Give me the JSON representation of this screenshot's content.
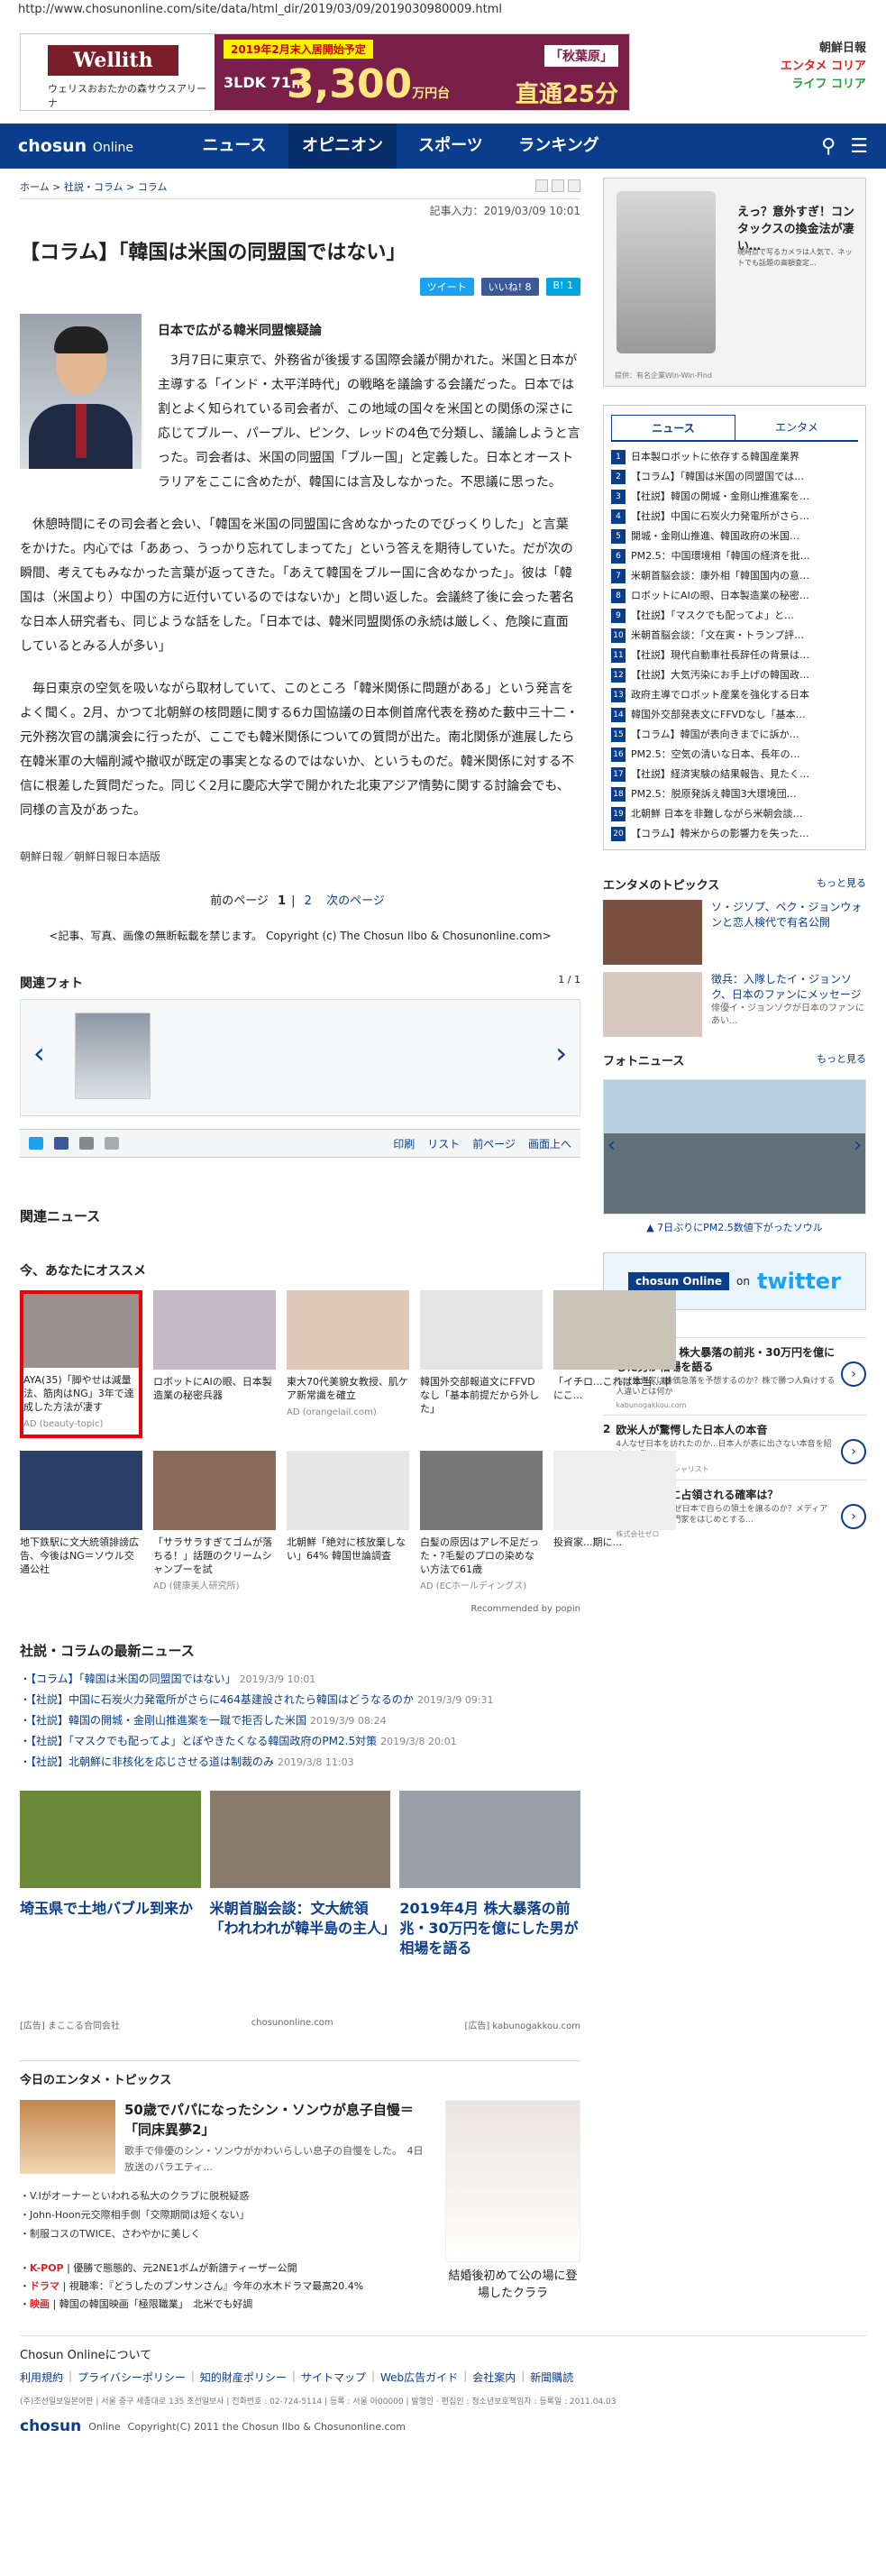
{
  "url": "http://www.chosunonline.com/site/data/html_dir/2019/03/09/2019030980009.html",
  "top_ad": {
    "brand": "Wellith",
    "brand_sub": "ウェリスおおたかの森サウスアリーナ",
    "banner": "2019年2月末入居開始予定",
    "layout": "3LDK 71㎡",
    "price": "3,300",
    "price_unit": "万円台",
    "autumn": "「秋葉原」",
    "direct": "直通25分"
  },
  "corner_logos": [
    "朝鮮日報",
    "エンタメ コリア",
    "ライフ コリア"
  ],
  "nav": {
    "logo": "chosun",
    "logo_sub": "Online",
    "items": [
      "ニュース",
      "オピニオン",
      "スポーツ",
      "ランキング"
    ]
  },
  "breadcrumb": [
    "ホーム",
    "社説・コラム",
    "コラム"
  ],
  "dateline": "記事入力：2019/03/09 10:01",
  "title": "【コラム】「韓国は米国の同盟国ではない」",
  "social": {
    "tweet": "ツイート",
    "like": "いいね! 8",
    "hatena": "B! 1"
  },
  "article": {
    "subtitle": "日本で広がる韓米同盟懐疑論",
    "paragraphs": [
      "3月7日に東京で、外務省が後援する国際会議が開かれた。米国と日本が主導する「インド・太平洋時代」の戦略を議論する会議だった。日本では割とよく知られている司会者が、この地域の国々を米国との関係の深さに応じてブルー、パープル、ピンク、レッドの4色で分類し、議論しようと言った。司会者は、米国の同盟国「ブルー国」と定義した。日本とオーストラリアをここに含めたが、韓国には言及しなかった。不思議に思った。",
      "休憩時間にその司会者と会い、「韓国を米国の同盟国に含めなかったのでびっくりした」と言葉をかけた。内心では「ああっ、うっかり忘れてしまってた」という答えを期待していた。だが次の瞬間、考えてもみなかった言葉が返ってきた。「あえて韓国をブルー国に含めなかった」。彼は「韓国は（米国より）中国の方に近付いているのではないか」と問い返した。会議終了後に会った著名な日本人研究者も、同じような話をした。「日本では、韓米同盟関係の永続は厳しく、危険に直面しているとみる人が多い」",
      "毎日東京の空気を吸いながら取材していて、このところ「韓米関係に問題がある」という発言をよく聞く。2月、かつて北朝鮮の核問題に関する6カ国協議の日本側首席代表を務めた藪中三十二・元外務次官の講演会に行ったが、ここでも韓米関係についての質問が出た。南北関係が進展したら在韓米軍の大幅削減や撤収が既定の事実となるのではないか、というものだ。韓米関係に対する不信に根差した質問だった。同じく2月に慶応大学で開かれた北東アジア情勢に関する討論会でも、同様の言及があった。"
    ],
    "source": "朝鮮日報／朝鮮日報日本語版"
  },
  "pager": {
    "prev": "前のページ",
    "current": "1",
    "next_page": "2",
    "next": "次のページ"
  },
  "copyright_notice": "<記事、写真、画像の無断転載を禁じます。 Copyright (c) The Chosun Ilbo & Chosunonline.com>",
  "related_photo": {
    "title": "関連フォト",
    "count": "1 / 1"
  },
  "tools": [
    "印刷",
    "リスト",
    "前ページ",
    "画面上へ"
  ],
  "related_news_title": "関連ニュース",
  "recommend": {
    "title": "今、あなたにオススメ",
    "items": [
      {
        "text": "AYA(35)「脚やせは減量法、筋肉はNG」3年で達成した方法が凄す",
        "ad": "AD (beauty-topic)",
        "color": "#9a8f8a",
        "selected": true
      },
      {
        "text": "ロボットにAIの眼、日本製造業の秘密兵器",
        "ad": "",
        "color": "#c7b8c8",
        "selected": false
      },
      {
        "text": "東大70代美貌女教授、肌ケア新常識を確立",
        "ad": "AD (orangelail.com)",
        "color": "#e0c8b8",
        "selected": false
      },
      {
        "text": "韓国外交部報道文にFFVDなし「基本前提だから外した」",
        "ad": "",
        "color": "#e4e4e4",
        "selected": false
      },
      {
        "text": "「イチロ...これは本当...単にこ...",
        "ad": "",
        "color": "#c9c3b8",
        "selected": false
      },
      {
        "text": "地下鉄駅に文大統領誹謗広告、今後はNG＝ソウル交通公社",
        "ad": "",
        "color": "#2c3f66",
        "selected": false
      },
      {
        "text": "「サラサラすぎてゴムが落ちる！」話題のクリームシャンプーを試",
        "ad": "AD (健康美人研究所)",
        "color": "#8a6a5a",
        "selected": false
      },
      {
        "text": "北朝鮮「絶対に核放棄しない」64% 韓国世論調査",
        "ad": "",
        "color": "#e6e6e6",
        "selected": false
      },
      {
        "text": "白髪の原因はアレ不足だった・?毛髪のプロの染めない方法で61歳",
        "ad": "AD (ECホールディングス)",
        "color": "#777",
        "selected": false
      },
      {
        "text": "投資家...期に...",
        "ad": "",
        "color": "#eee",
        "selected": false
      }
    ],
    "popin": "Recommended by popin"
  },
  "latest": {
    "title": "社説・コラムの最新ニュース",
    "items": [
      {
        "text": "【コラム】「韓国は米国の同盟国ではない」",
        "date": "2019/3/9 10:01"
      },
      {
        "text": "【社説】中国に石炭火力発電所がさらに464基建設されたら韓国はどうなるのか",
        "date": "2019/3/9 09:31"
      },
      {
        "text": "【社説】韓国の開城・金剛山推進案を一蹴で拒否した米国",
        "date": "2019/3/9 08:24"
      },
      {
        "text": "【社説】「マスクでも配ってよ」とぼやきたくなる韓国政府のPM2.5対策",
        "date": "2019/3/8 20:01"
      },
      {
        "text": "【社説】北朝鮮に非核化を応じさせる道は制裁のみ",
        "date": "2019/3/8 11:03"
      }
    ]
  },
  "cards": [
    {
      "title": "埼玉県で土地バブル到来か",
      "color": "#6a8a3a"
    },
    {
      "title": "米朝首脳会談：文大統領「われわれが韓半島の主人」",
      "color": "#8a7a6a"
    },
    {
      "title": "2019年4月 株大暴落の前兆・30万円を億にした男が相場を語る",
      "color": "#9aa0a8"
    }
  ],
  "card_sources": [
    "[広告] まここる合同会社",
    "chosunonline.com",
    "[広告] kabunogakkou.com"
  ],
  "entertainment": {
    "title": "今日のエンタメ・トピックス",
    "feature_title": "50歳でパパになったシン・ソンウが息子自慢＝「同床異夢2」",
    "feature_desc": "歌手で俳優のシン・ソンウがかわいらしい息子の自慢をした。　4日放送のバラエティ...",
    "links": [
      "V.Iがオーナーといわれる私大のクラブに脱税疑惑",
      "John-Hoon元交際相手側「交際期間は短くない」",
      "制服コスのTWICE、さわやかに美しく"
    ],
    "tags": [
      {
        "tag": "K-POP",
        "text": "優勝で態態的、元2NE1ボムが新譜ティーザー公開"
      },
      {
        "tag": "ドラマ",
        "text": "視聴率：『どうしたのブンサンさん』今年の水木ドラマ最高20.4%"
      },
      {
        "tag": "映画",
        "text": "韓国の韓国映画「極限職業」　北米でも好調"
      }
    ],
    "right_caption": "結婚後初めて公の場に登場したクララ"
  },
  "side_ad": {
    "headline": "えっ？意外すぎ！コンタックスの換金法が凄い…",
    "desc": "現時点で写るカメラは人気で、ネットでも話題の高額査定...",
    "sponsor": "提供：有名企業Win-Win-Find"
  },
  "ranking": {
    "tabs": [
      "ニュース",
      "エンタメ"
    ],
    "items": [
      "日本製ロボットに依存する韓国産業界",
      "【コラム】「韓国は米国の同盟国では…",
      "【社説】韓国の開城・金剛山推進案を…",
      "【社説】中国に石炭火力発電所がさら…",
      "開城・金剛山推進、韓国政府の米国…",
      "PM2.5：中国環境相「韓国の経済を批…",
      "米朝首脳会談：康外相「韓国国内の意…",
      "ロボットにAIの眼、日本製造業の秘密…",
      "【社説】「マスクでも配ってよ」と…",
      "米朝首脳会談：「文在寅・トランプ評…",
      "【社説】現代自動車社長辞任の背景は…",
      "【社説】大気汚染にお手上げの韓国政…",
      "政府主導でロボット産業を強化する日本",
      "韓国外交部発表文にFFVDなし「基本…",
      "【コラム】韓国が表向きまでに訴か…",
      "PM2.5：空気の清いな日本、長年の…",
      "【社説】経済実験の結果報告、見たく…",
      "PM2.5：脱原発訴え韓国3大環境団…",
      "北朝鮮 日本を非難しながら米朝会談…",
      "【コラム】韓米からの影響力を失った…"
    ]
  },
  "ent_topics": {
    "title": "エンタメのトピックス",
    "more": "もっと見る",
    "items": [
      {
        "title": "ソ・ジソプ、ペク・ジョンウォンと恋人検代で有名公開",
        "desc": "",
        "color": "#7a5040"
      },
      {
        "title": "徴兵：入隊したイ・ジョンソク、日本のファンにメッセージ",
        "desc": "俳優イ・ジョンソクが日本のファンにあい...",
        "color": "#d8c8c0"
      }
    ]
  },
  "photo_news": {
    "title": "フォトニュース",
    "more": "もっと見る",
    "caption": "▲ 7日ぶりにPM2.5数値下がったソウル"
  },
  "twitter_banner": {
    "label": "chosun Online",
    "on": "on",
    "twitter": "twitter"
  },
  "side_sponsored": [
    {
      "num": "1",
      "headline": "2019年4月 株大暴落の前兆・30万円を億にした男が相場を語る",
      "desc": "なぜ投資家は株価急落を予想するのか？株で勝つ人負けする人違いとは何か",
      "src": "kabunogakkou.com"
    },
    {
      "num": "2",
      "headline": "欧米人が驚愕した日本人の本音",
      "desc": "4人なぜ日本を訪れたのか...日本人が表に出さない本音を紹介する動画",
      "src": "インバウンドスペシャリスト"
    },
    {
      "num": "3",
      "headline": "沖縄が中国に占領される確率は？",
      "desc": "朝日、NHK、なぜ日本で自らの領土を譲るのか？メディアを強く責める専門家をはじめとする…",
      "src": "株式会社ゼロ"
    }
  ],
  "footer": {
    "about": "Chosun Onlineについて",
    "links": [
      "利用規約",
      "プライバシーポリシー",
      "知的財産ポリシー",
      "サイトマップ",
      "Web広告ガイド",
      "会社案内",
      "新聞購読"
    ],
    "legal": "(주)조선일보일본어판 | 서울 중구 세종대로 135 조선일보사 | 전화번호 : 02-724-5114 | 등록 : 서울 아00000 | 발행인 · 편집인 : 청소년보호책임자 : 등록일 : 2011.04.03",
    "logo": "chosun",
    "logo_sub": "Online",
    "copyright": "Copyright(C) 2011 the Chosun Ilbo & Chosunonline.com"
  },
  "colors": {
    "brand_navy": "#0a3e8c",
    "accent_red": "#dd2222"
  }
}
